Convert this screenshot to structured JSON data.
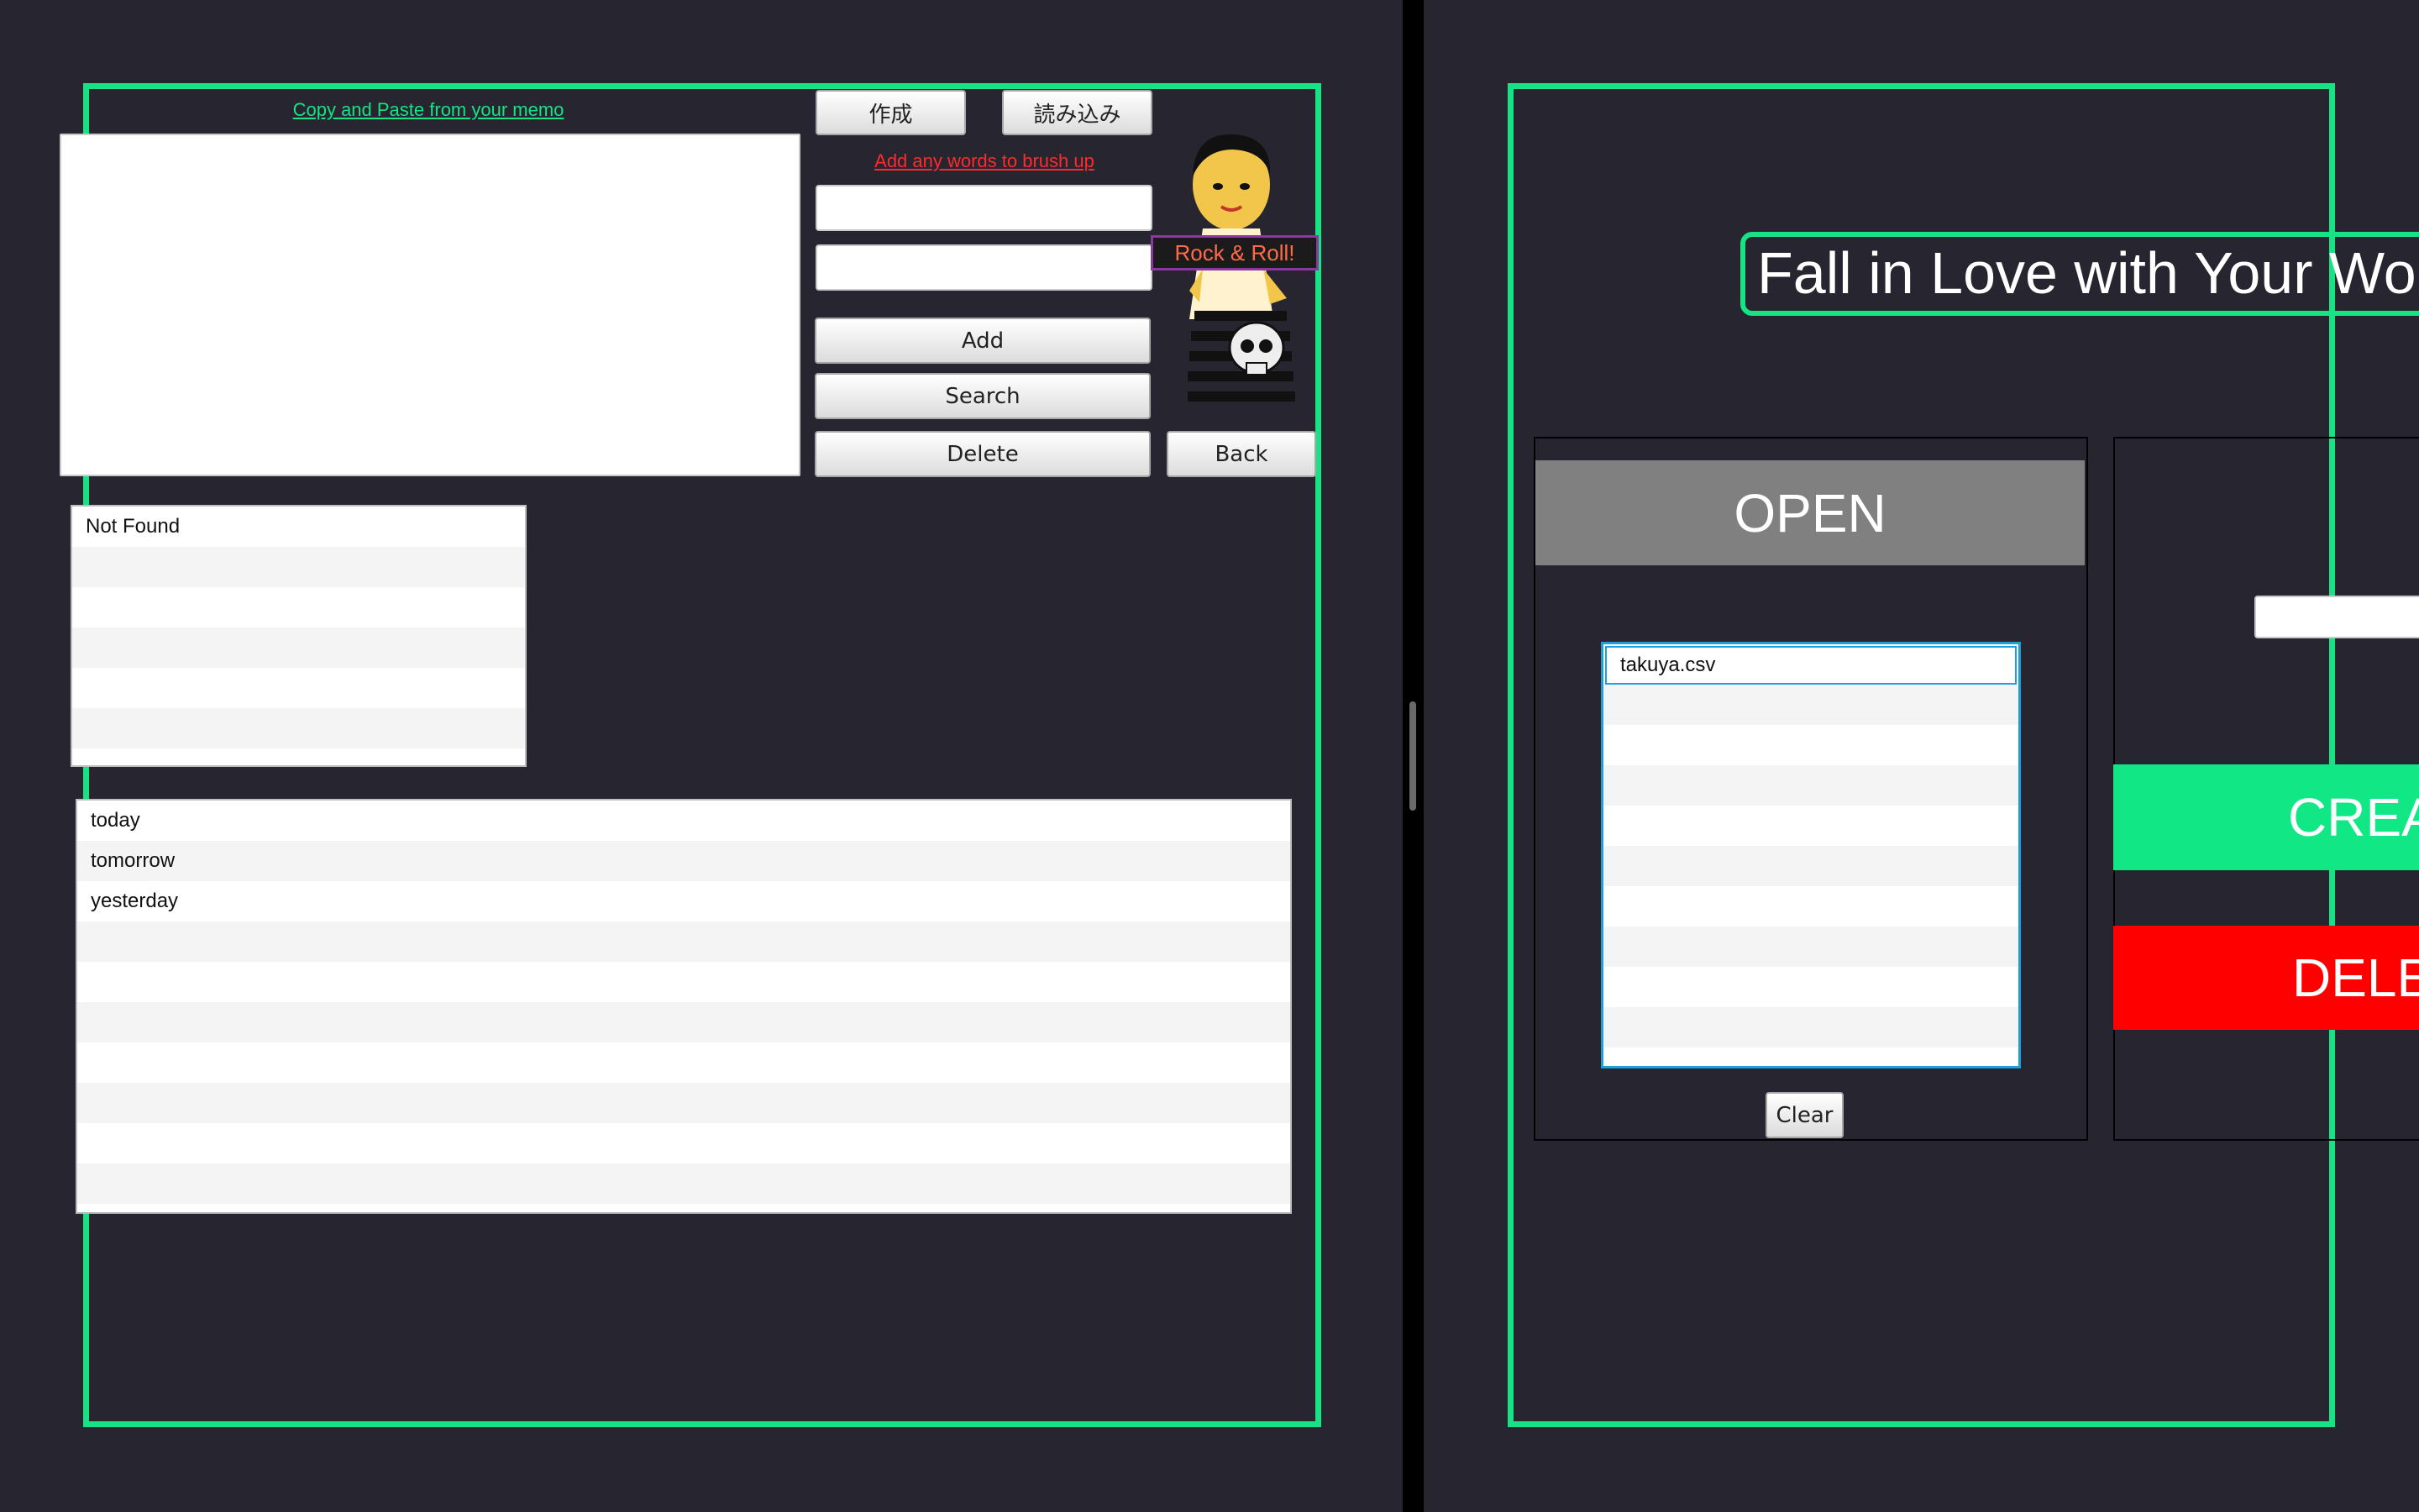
{
  "left": {
    "paste_link": "Copy and Paste from your memo",
    "create_button": "作成",
    "load_button": "読み込み",
    "add_words_link": "Add any words to brush up",
    "add_button": "Add",
    "search_button": "Search",
    "delete_button": "Delete",
    "back_button": "Back",
    "banner": "Rock & Roll!",
    "search_results": [
      "Not Found",
      "",
      "",
      "",
      "",
      ""
    ],
    "word_list": [
      "today",
      "tomorrow",
      "yesterday",
      "",
      "",
      "",
      "",
      "",
      "",
      ""
    ]
  },
  "right": {
    "title": "Fall in Love with Your Word",
    "open_button": "OPEN",
    "files": [
      "takuya.csv",
      "",
      "",
      "",
      "",
      "",
      "",
      "",
      "",
      "",
      ""
    ],
    "clear_button": "Clear",
    "create_button": "CREA",
    "delete_button": "DELE"
  },
  "colors": {
    "background": "#272530",
    "accent": "#17e284",
    "danger": "#ff0000",
    "open": "#808080"
  }
}
